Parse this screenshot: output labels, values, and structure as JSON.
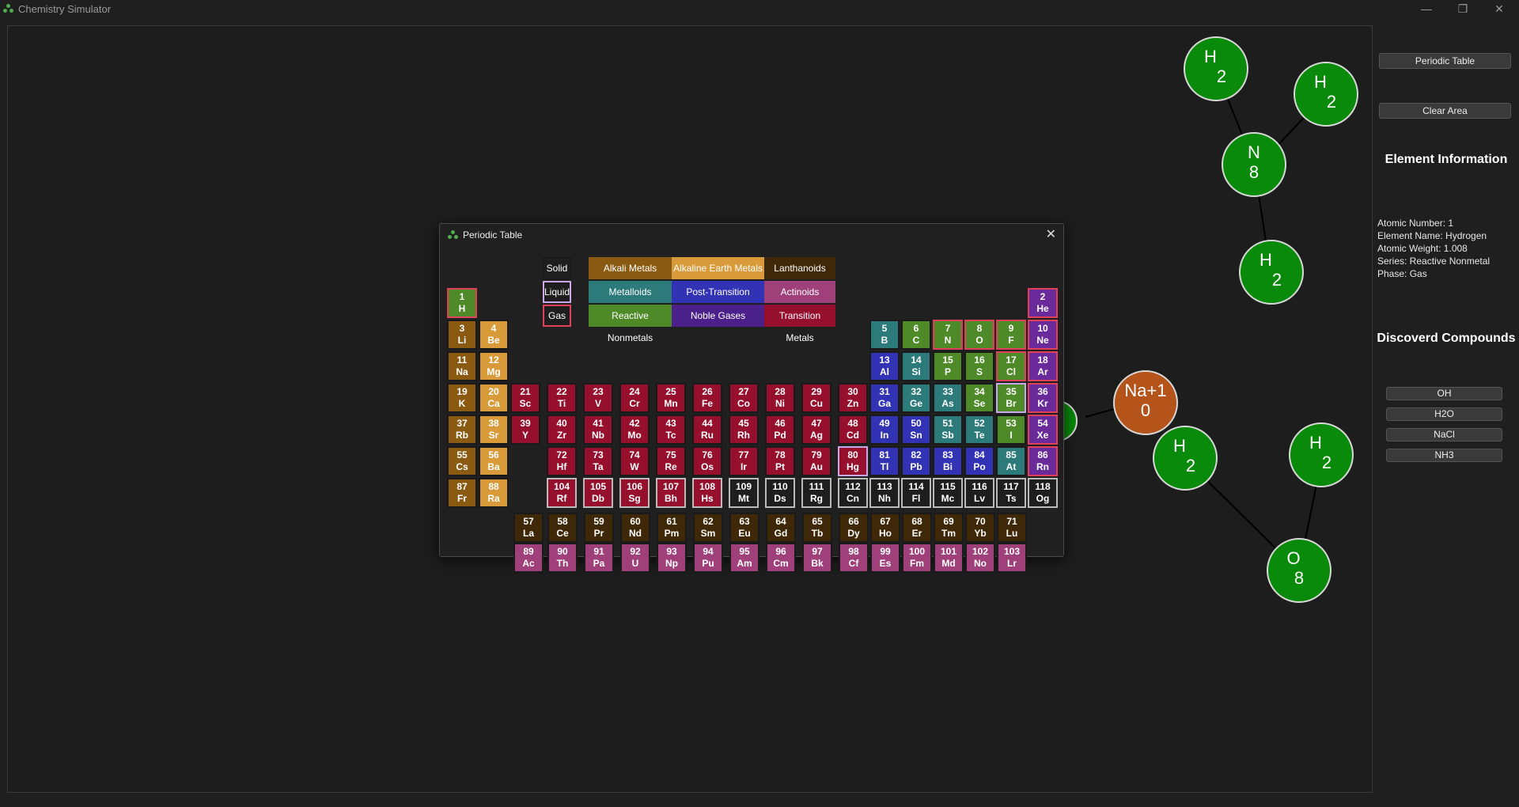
{
  "app": {
    "title": "Chemistry Simulator",
    "minimize": "—",
    "maximize": "❐",
    "close": "✕"
  },
  "panel": {
    "periodic_table_button": "Periodic Table",
    "clear_area_button": "Clear Area",
    "element_info_heading": "Element Information",
    "info": {
      "atomic_number": "Atomic Number: 1",
      "element_name": "Element Name: Hydrogen",
      "atomic_weight": "Atomic Weight: 1.008",
      "series": "Series: Reactive Nonmetal",
      "phase": "Phase: Gas"
    },
    "compounds_heading": "Discoverd Compounds",
    "compounds": [
      "OH",
      "H2O",
      "NaCl",
      "NH3"
    ]
  },
  "canvas": {
    "atoms": [
      {
        "symbol": "H",
        "number": "2"
      },
      {
        "symbol": "H",
        "number": "2"
      },
      {
        "symbol": "N",
        "number": "8"
      },
      {
        "symbol": "H",
        "number": "2"
      },
      {
        "symbol": "Na+1",
        "number": "0"
      },
      {
        "symbol": "H",
        "number": "2"
      },
      {
        "symbol": "H",
        "number": "2"
      },
      {
        "symbol": "O",
        "number": "8"
      }
    ]
  },
  "dialog": {
    "title": "Periodic Table",
    "close": "✕",
    "phases": [
      "Solid",
      "Liquid",
      "Gas"
    ],
    "legend": [
      "Alkali Metals",
      "Alkaline Earth Metals",
      "Lanthanoids",
      "Metalloids",
      "Post-Transition Metals",
      "Actinoids",
      "Reactive Nonmetals",
      "Noble Gases",
      "Transition Metals"
    ]
  },
  "colors": {
    "alkali": "#8a5a12",
    "alkaline_earth": "#d99a3a",
    "lanthanoid": "#3e2808",
    "metalloid": "#2c7a7a",
    "post_transition": "#3232b4",
    "actinoid": "#a0407a",
    "reactive_nonmetal": "#4e8a28",
    "noble_gas": "#6a2a9a",
    "transition": "#960f2d",
    "unknown": "#1e1e1e",
    "gas_border": "#e0405a",
    "liquid_border": "#c8a8e8",
    "solid_border": "#1a1a1a",
    "unknown_border": "#bbbbbb",
    "atom_green": "#0a8a0a",
    "atom_sodium": "#b4531a"
  },
  "elements": [
    {
      "n": "1",
      "s": "H",
      "c": "reactive_nonmetal",
      "p": "gas"
    },
    {
      "n": "2",
      "s": "He",
      "c": "noble_gas",
      "p": "gas"
    },
    {
      "n": "3",
      "s": "Li",
      "c": "alkali",
      "p": "solid"
    },
    {
      "n": "4",
      "s": "Be",
      "c": "alkaline_earth",
      "p": "solid"
    },
    {
      "n": "5",
      "s": "B",
      "c": "metalloid",
      "p": "solid"
    },
    {
      "n": "6",
      "s": "C",
      "c": "reactive_nonmetal",
      "p": "solid"
    },
    {
      "n": "7",
      "s": "N",
      "c": "reactive_nonmetal",
      "p": "gas"
    },
    {
      "n": "8",
      "s": "O",
      "c": "reactive_nonmetal",
      "p": "gas"
    },
    {
      "n": "9",
      "s": "F",
      "c": "reactive_nonmetal",
      "p": "gas"
    },
    {
      "n": "10",
      "s": "Ne",
      "c": "noble_gas",
      "p": "gas"
    },
    {
      "n": "11",
      "s": "Na",
      "c": "alkali",
      "p": "solid"
    },
    {
      "n": "12",
      "s": "Mg",
      "c": "alkaline_earth",
      "p": "solid"
    },
    {
      "n": "13",
      "s": "Al",
      "c": "post_transition",
      "p": "solid"
    },
    {
      "n": "14",
      "s": "Si",
      "c": "metalloid",
      "p": "solid"
    },
    {
      "n": "15",
      "s": "P",
      "c": "reactive_nonmetal",
      "p": "solid"
    },
    {
      "n": "16",
      "s": "S",
      "c": "reactive_nonmetal",
      "p": "solid"
    },
    {
      "n": "17",
      "s": "Cl",
      "c": "reactive_nonmetal",
      "p": "gas"
    },
    {
      "n": "18",
      "s": "Ar",
      "c": "noble_gas",
      "p": "gas"
    },
    {
      "n": "19",
      "s": "K",
      "c": "alkali",
      "p": "solid"
    },
    {
      "n": "20",
      "s": "Ca",
      "c": "alkaline_earth",
      "p": "solid"
    },
    {
      "n": "21",
      "s": "Sc",
      "c": "transition",
      "p": "solid"
    },
    {
      "n": "22",
      "s": "Ti",
      "c": "transition",
      "p": "solid"
    },
    {
      "n": "23",
      "s": "V",
      "c": "transition",
      "p": "solid"
    },
    {
      "n": "24",
      "s": "Cr",
      "c": "transition",
      "p": "solid"
    },
    {
      "n": "25",
      "s": "Mn",
      "c": "transition",
      "p": "solid"
    },
    {
      "n": "26",
      "s": "Fe",
      "c": "transition",
      "p": "solid"
    },
    {
      "n": "27",
      "s": "Co",
      "c": "transition",
      "p": "solid"
    },
    {
      "n": "28",
      "s": "Ni",
      "c": "transition",
      "p": "solid"
    },
    {
      "n": "29",
      "s": "Cu",
      "c": "transition",
      "p": "solid"
    },
    {
      "n": "30",
      "s": "Zn",
      "c": "transition",
      "p": "solid"
    },
    {
      "n": "31",
      "s": "Ga",
      "c": "post_transition",
      "p": "solid"
    },
    {
      "n": "32",
      "s": "Ge",
      "c": "metalloid",
      "p": "solid"
    },
    {
      "n": "33",
      "s": "As",
      "c": "metalloid",
      "p": "solid"
    },
    {
      "n": "34",
      "s": "Se",
      "c": "reactive_nonmetal",
      "p": "solid"
    },
    {
      "n": "35",
      "s": "Br",
      "c": "reactive_nonmetal",
      "p": "liquid"
    },
    {
      "n": "36",
      "s": "Kr",
      "c": "noble_gas",
      "p": "gas"
    },
    {
      "n": "37",
      "s": "Rb",
      "c": "alkali",
      "p": "solid"
    },
    {
      "n": "38",
      "s": "Sr",
      "c": "alkaline_earth",
      "p": "solid"
    },
    {
      "n": "39",
      "s": "Y",
      "c": "transition",
      "p": "solid"
    },
    {
      "n": "40",
      "s": "Zr",
      "c": "transition",
      "p": "solid"
    },
    {
      "n": "41",
      "s": "Nb",
      "c": "transition",
      "p": "solid"
    },
    {
      "n": "42",
      "s": "Mo",
      "c": "transition",
      "p": "solid"
    },
    {
      "n": "43",
      "s": "Tc",
      "c": "transition",
      "p": "solid"
    },
    {
      "n": "44",
      "s": "Ru",
      "c": "transition",
      "p": "solid"
    },
    {
      "n": "45",
      "s": "Rh",
      "c": "transition",
      "p": "solid"
    },
    {
      "n": "46",
      "s": "Pd",
      "c": "transition",
      "p": "solid"
    },
    {
      "n": "47",
      "s": "Ag",
      "c": "transition",
      "p": "solid"
    },
    {
      "n": "48",
      "s": "Cd",
      "c": "transition",
      "p": "solid"
    },
    {
      "n": "49",
      "s": "In",
      "c": "post_transition",
      "p": "solid"
    },
    {
      "n": "50",
      "s": "Sn",
      "c": "post_transition",
      "p": "solid"
    },
    {
      "n": "51",
      "s": "Sb",
      "c": "metalloid",
      "p": "solid"
    },
    {
      "n": "52",
      "s": "Te",
      "c": "metalloid",
      "p": "solid"
    },
    {
      "n": "53",
      "s": "I",
      "c": "reactive_nonmetal",
      "p": "solid"
    },
    {
      "n": "54",
      "s": "Xe",
      "c": "noble_gas",
      "p": "gas"
    },
    {
      "n": "55",
      "s": "Cs",
      "c": "alkali",
      "p": "solid"
    },
    {
      "n": "56",
      "s": "Ba",
      "c": "alkaline_earth",
      "p": "solid"
    },
    {
      "n": "72",
      "s": "Hf",
      "c": "transition",
      "p": "solid"
    },
    {
      "n": "73",
      "s": "Ta",
      "c": "transition",
      "p": "solid"
    },
    {
      "n": "74",
      "s": "W",
      "c": "transition",
      "p": "solid"
    },
    {
      "n": "75",
      "s": "Re",
      "c": "transition",
      "p": "solid"
    },
    {
      "n": "76",
      "s": "Os",
      "c": "transition",
      "p": "solid"
    },
    {
      "n": "77",
      "s": "Ir",
      "c": "transition",
      "p": "solid"
    },
    {
      "n": "78",
      "s": "Pt",
      "c": "transition",
      "p": "solid"
    },
    {
      "n": "79",
      "s": "Au",
      "c": "transition",
      "p": "solid"
    },
    {
      "n": "80",
      "s": "Hg",
      "c": "transition",
      "p": "liquid"
    },
    {
      "n": "81",
      "s": "Tl",
      "c": "post_transition",
      "p": "solid"
    },
    {
      "n": "82",
      "s": "Pb",
      "c": "post_transition",
      "p": "solid"
    },
    {
      "n": "83",
      "s": "Bi",
      "c": "post_transition",
      "p": "solid"
    },
    {
      "n": "84",
      "s": "Po",
      "c": "post_transition",
      "p": "solid"
    },
    {
      "n": "85",
      "s": "At",
      "c": "metalloid",
      "p": "solid"
    },
    {
      "n": "86",
      "s": "Rn",
      "c": "noble_gas",
      "p": "gas"
    },
    {
      "n": "87",
      "s": "Fr",
      "c": "alkali",
      "p": "solid"
    },
    {
      "n": "88",
      "s": "Ra",
      "c": "alkaline_earth",
      "p": "solid"
    },
    {
      "n": "104",
      "s": "Rf",
      "c": "transition",
      "p": "unknown"
    },
    {
      "n": "105",
      "s": "Db",
      "c": "transition",
      "p": "unknown"
    },
    {
      "n": "106",
      "s": "Sg",
      "c": "transition",
      "p": "unknown"
    },
    {
      "n": "107",
      "s": "Bh",
      "c": "transition",
      "p": "unknown"
    },
    {
      "n": "108",
      "s": "Hs",
      "c": "transition",
      "p": "unknown"
    },
    {
      "n": "109",
      "s": "Mt",
      "c": "unknown",
      "p": "unknown"
    },
    {
      "n": "110",
      "s": "Ds",
      "c": "unknown",
      "p": "unknown"
    },
    {
      "n": "111",
      "s": "Rg",
      "c": "unknown",
      "p": "unknown"
    },
    {
      "n": "112",
      "s": "Cn",
      "c": "unknown",
      "p": "unknown"
    },
    {
      "n": "113",
      "s": "Nh",
      "c": "unknown",
      "p": "unknown"
    },
    {
      "n": "114",
      "s": "Fl",
      "c": "unknown",
      "p": "unknown"
    },
    {
      "n": "115",
      "s": "Mc",
      "c": "unknown",
      "p": "unknown"
    },
    {
      "n": "116",
      "s": "Lv",
      "c": "unknown",
      "p": "unknown"
    },
    {
      "n": "117",
      "s": "Ts",
      "c": "unknown",
      "p": "unknown"
    },
    {
      "n": "118",
      "s": "Og",
      "c": "unknown",
      "p": "unknown"
    },
    {
      "n": "57",
      "s": "La",
      "c": "lanthanoid",
      "p": "solid"
    },
    {
      "n": "58",
      "s": "Ce",
      "c": "lanthanoid",
      "p": "solid"
    },
    {
      "n": "59",
      "s": "Pr",
      "c": "lanthanoid",
      "p": "solid"
    },
    {
      "n": "60",
      "s": "Nd",
      "c": "lanthanoid",
      "p": "solid"
    },
    {
      "n": "61",
      "s": "Pm",
      "c": "lanthanoid",
      "p": "solid"
    },
    {
      "n": "62",
      "s": "Sm",
      "c": "lanthanoid",
      "p": "solid"
    },
    {
      "n": "63",
      "s": "Eu",
      "c": "lanthanoid",
      "p": "solid"
    },
    {
      "n": "64",
      "s": "Gd",
      "c": "lanthanoid",
      "p": "solid"
    },
    {
      "n": "65",
      "s": "Tb",
      "c": "lanthanoid",
      "p": "solid"
    },
    {
      "n": "66",
      "s": "Dy",
      "c": "lanthanoid",
      "p": "solid"
    },
    {
      "n": "67",
      "s": "Ho",
      "c": "lanthanoid",
      "p": "solid"
    },
    {
      "n": "68",
      "s": "Er",
      "c": "lanthanoid",
      "p": "solid"
    },
    {
      "n": "69",
      "s": "Tm",
      "c": "lanthanoid",
      "p": "solid"
    },
    {
      "n": "70",
      "s": "Yb",
      "c": "lanthanoid",
      "p": "solid"
    },
    {
      "n": "71",
      "s": "Lu",
      "c": "lanthanoid",
      "p": "solid"
    },
    {
      "n": "89",
      "s": "Ac",
      "c": "actinoid",
      "p": "solid"
    },
    {
      "n": "90",
      "s": "Th",
      "c": "actinoid",
      "p": "solid"
    },
    {
      "n": "91",
      "s": "Pa",
      "c": "actinoid",
      "p": "solid"
    },
    {
      "n": "92",
      "s": "U",
      "c": "actinoid",
      "p": "solid"
    },
    {
      "n": "93",
      "s": "Np",
      "c": "actinoid",
      "p": "solid"
    },
    {
      "n": "94",
      "s": "Pu",
      "c": "actinoid",
      "p": "solid"
    },
    {
      "n": "95",
      "s": "Am",
      "c": "actinoid",
      "p": "solid"
    },
    {
      "n": "96",
      "s": "Cm",
      "c": "actinoid",
      "p": "solid"
    },
    {
      "n": "97",
      "s": "Bk",
      "c": "actinoid",
      "p": "solid"
    },
    {
      "n": "98",
      "s": "Cf",
      "c": "actinoid",
      "p": "solid"
    },
    {
      "n": "99",
      "s": "Es",
      "c": "actinoid",
      "p": "solid"
    },
    {
      "n": "100",
      "s": "Fm",
      "c": "actinoid",
      "p": "solid"
    },
    {
      "n": "101",
      "s": "Md",
      "c": "actinoid",
      "p": "solid"
    },
    {
      "n": "102",
      "s": "No",
      "c": "actinoid",
      "p": "solid"
    },
    {
      "n": "103",
      "s": "Lr",
      "c": "actinoid",
      "p": "solid"
    }
  ]
}
